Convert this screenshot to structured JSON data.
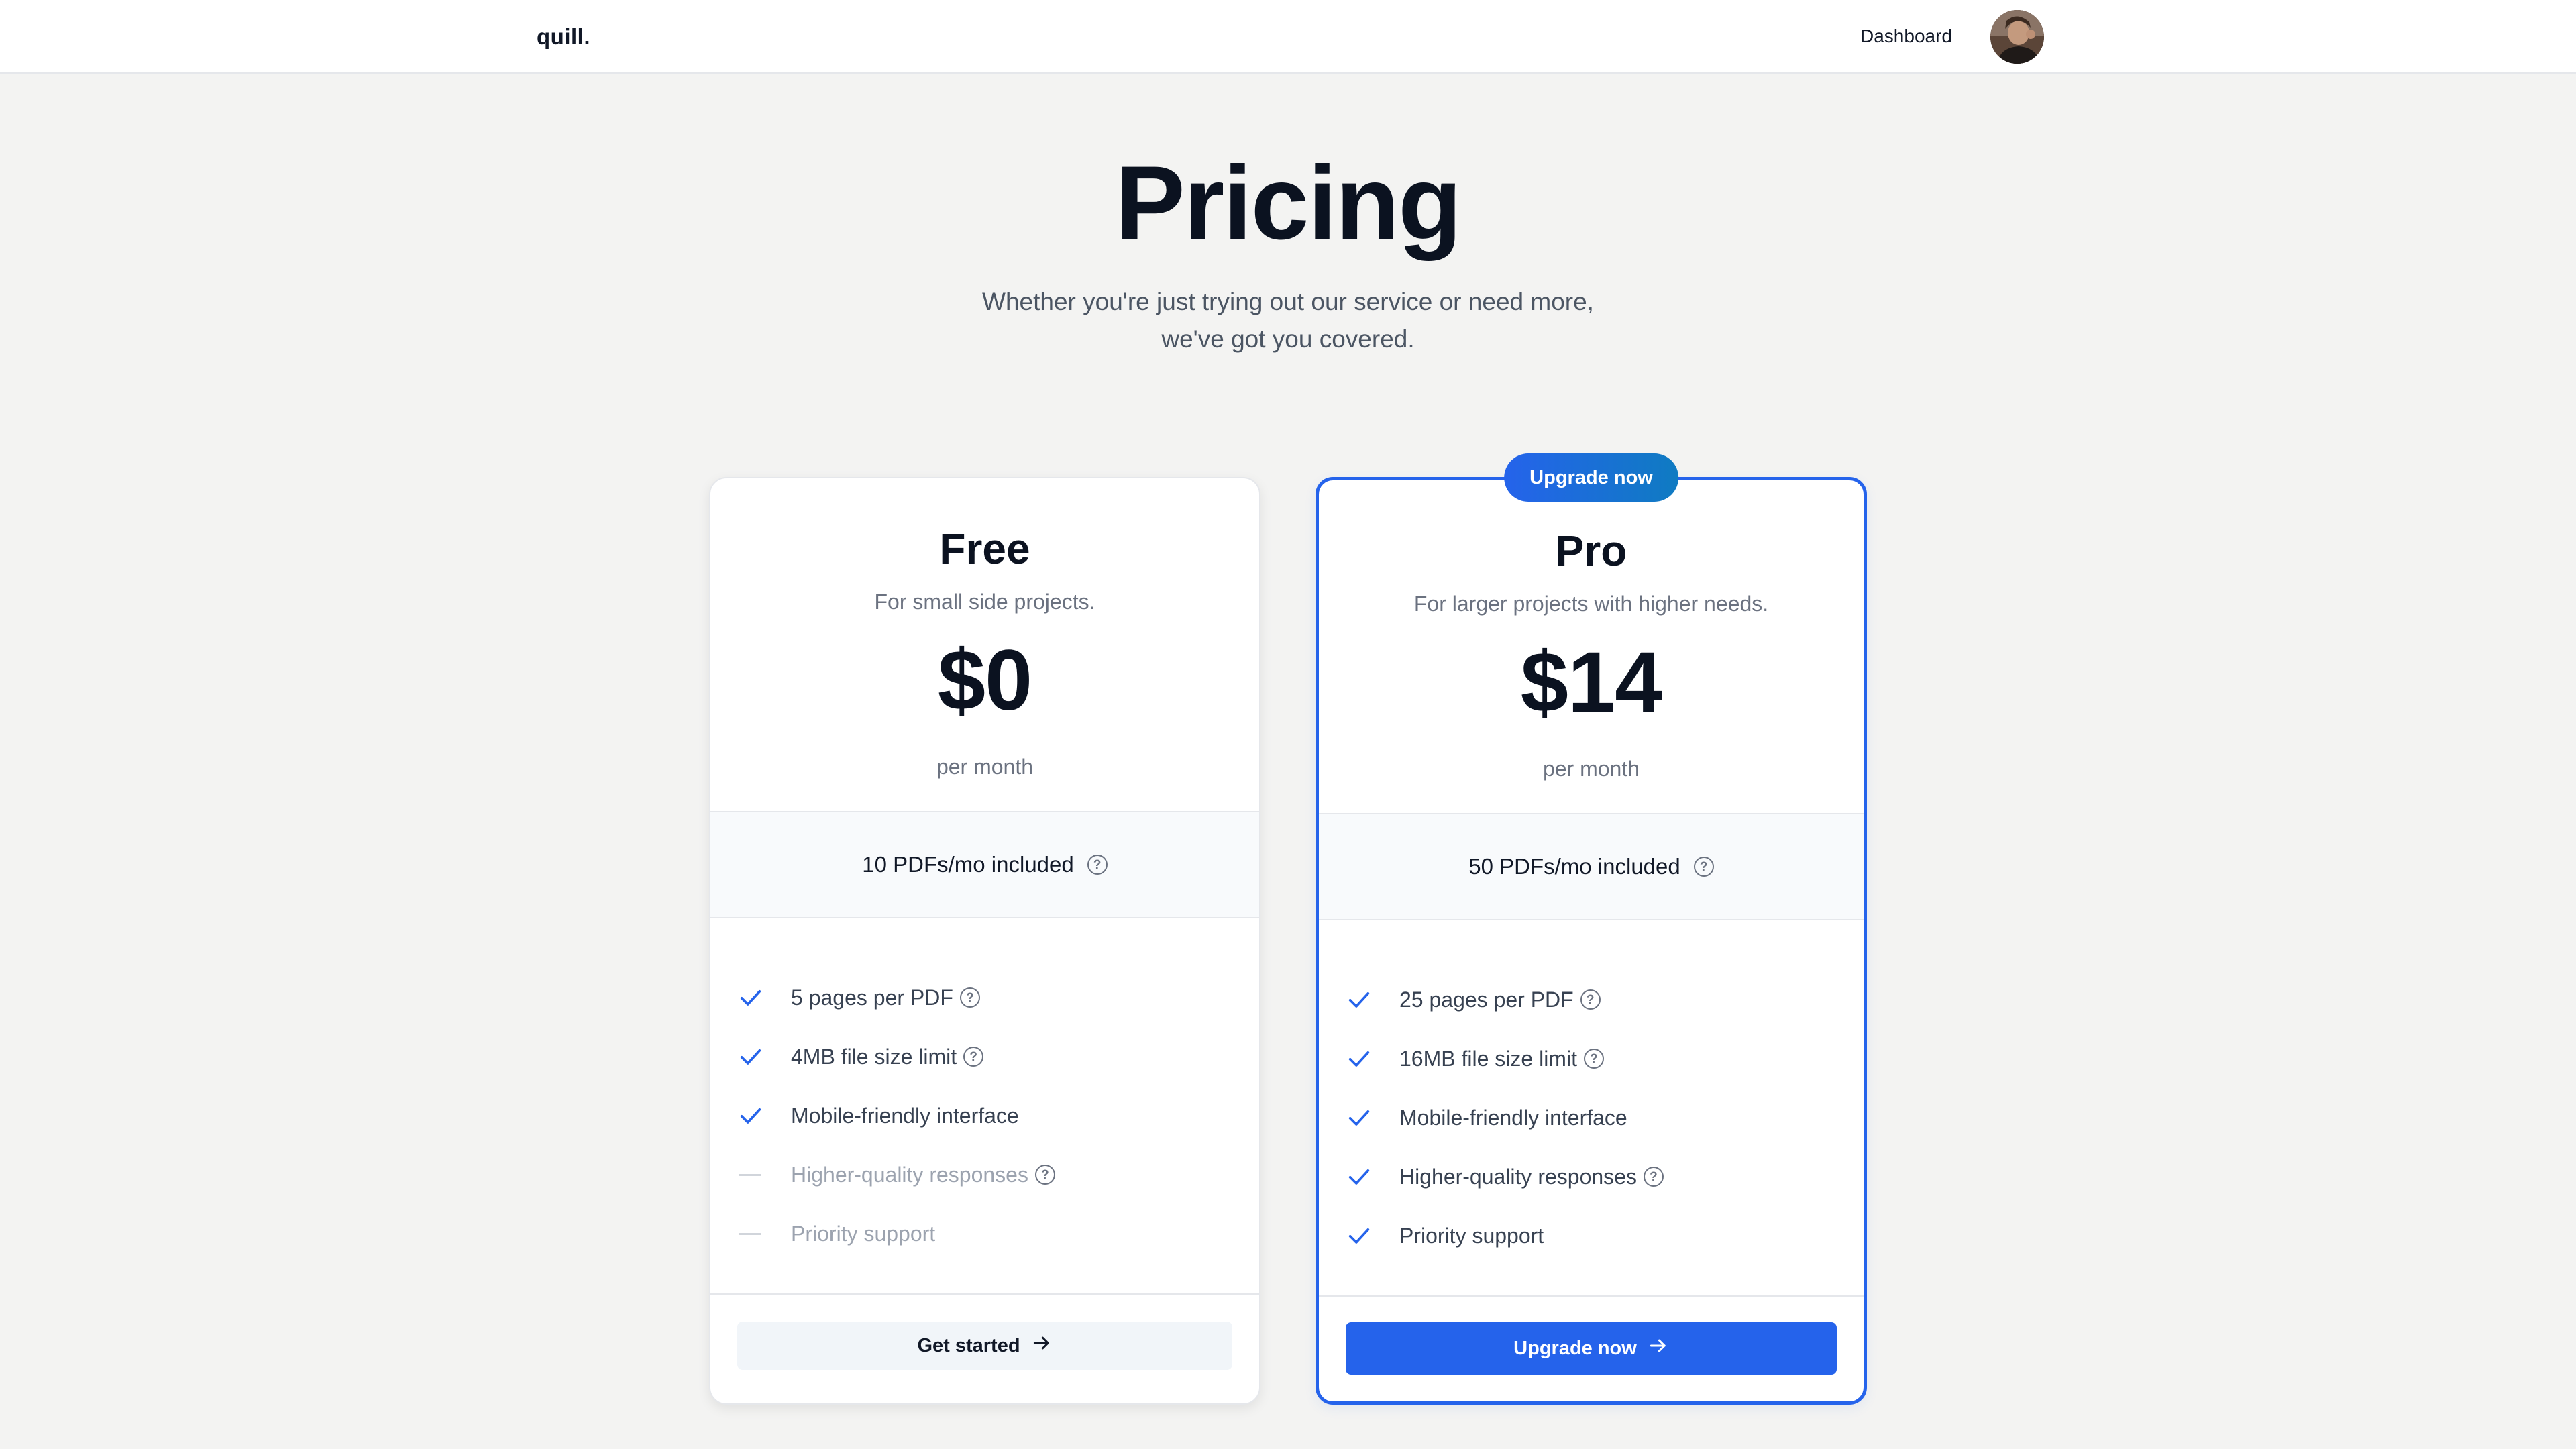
{
  "nav": {
    "logo": "quill.",
    "dashboard_label": "Dashboard"
  },
  "hero": {
    "title": "Pricing",
    "subtitle_line1": "Whether you're just trying out our service or need more,",
    "subtitle_line2": "we've got you covered."
  },
  "plans": [
    {
      "name": "Free",
      "tagline": "For small side projects.",
      "price": "$0",
      "period": "per month",
      "quota": "10 PDFs/mo included",
      "features": [
        {
          "text": "5 pages per PDF",
          "included": true,
          "help": true
        },
        {
          "text": "4MB file size limit",
          "included": true,
          "help": true
        },
        {
          "text": "Mobile-friendly interface",
          "included": true,
          "help": false
        },
        {
          "text": "Higher-quality responses",
          "included": false,
          "help": true
        },
        {
          "text": "Priority support",
          "included": false,
          "help": false
        }
      ],
      "cta": "Get started"
    },
    {
      "name": "Pro",
      "badge": "Upgrade now",
      "tagline": "For larger projects with higher needs.",
      "price": "$14",
      "period": "per month",
      "quota": "50 PDFs/mo included",
      "features": [
        {
          "text": "25 pages per PDF",
          "included": true,
          "help": true
        },
        {
          "text": "16MB file size limit",
          "included": true,
          "help": true
        },
        {
          "text": "Mobile-friendly interface",
          "included": true,
          "help": false
        },
        {
          "text": "Higher-quality responses",
          "included": true,
          "help": true
        },
        {
          "text": "Priority support",
          "included": true,
          "help": false
        }
      ],
      "cta": "Upgrade now"
    }
  ],
  "colors": {
    "accent": "#2563eb",
    "badge_gradient_end": "#0f7bc2",
    "background": "#f3f3f2"
  },
  "icons": {
    "check": "check-icon",
    "dash": "dash-icon",
    "help": "help-circle-icon",
    "arrow": "arrow-right-icon"
  }
}
